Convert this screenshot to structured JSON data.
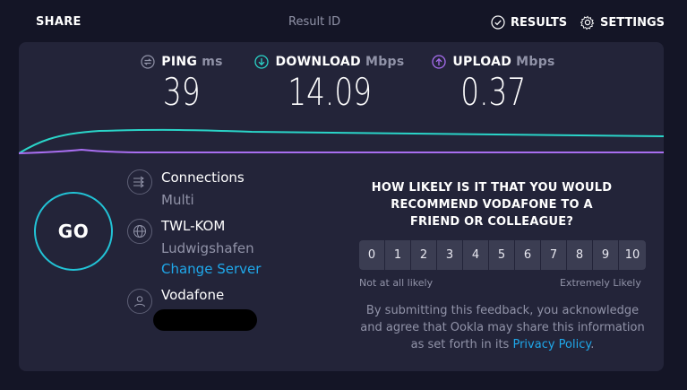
{
  "header": {
    "share_label": "SHARE",
    "result_id_label": "Result ID",
    "results_label": "RESULTS",
    "settings_label": "SETTINGS"
  },
  "metrics": {
    "ping": {
      "label": "PING",
      "unit": "ms",
      "value": "39"
    },
    "download": {
      "label": "DOWNLOAD",
      "unit": "Mbps",
      "value": "14.09"
    },
    "upload": {
      "label": "UPLOAD",
      "unit": "Mbps",
      "value": "0.37"
    }
  },
  "go_label": "GO",
  "connections": {
    "title": "Connections",
    "value": "Multi"
  },
  "server": {
    "name": "TWL-KOM",
    "location": "Ludwigshafen",
    "change_label": "Change Server"
  },
  "provider": {
    "name": "Vodafone"
  },
  "survey": {
    "question": "HOW LIKELY IS IT THAT YOU WOULD RECOMMEND VODAFONE TO A FRIEND OR COLLEAGUE?",
    "scale": [
      "0",
      "1",
      "2",
      "3",
      "4",
      "5",
      "6",
      "7",
      "8",
      "9",
      "10"
    ],
    "low_label": "Not at all likely",
    "high_label": "Extremely Likely",
    "disclaimer_prefix": "By submitting this feedback, you acknowledge and agree that Ookla may share this information as set forth in its ",
    "privacy_link": "Privacy Policy",
    "disclaimer_suffix": "."
  },
  "colors": {
    "background": "#141526",
    "panel": "#232439",
    "download_accent": "#2ad4c8",
    "upload_accent": "#a86ef0",
    "link": "#1fa8ea"
  }
}
